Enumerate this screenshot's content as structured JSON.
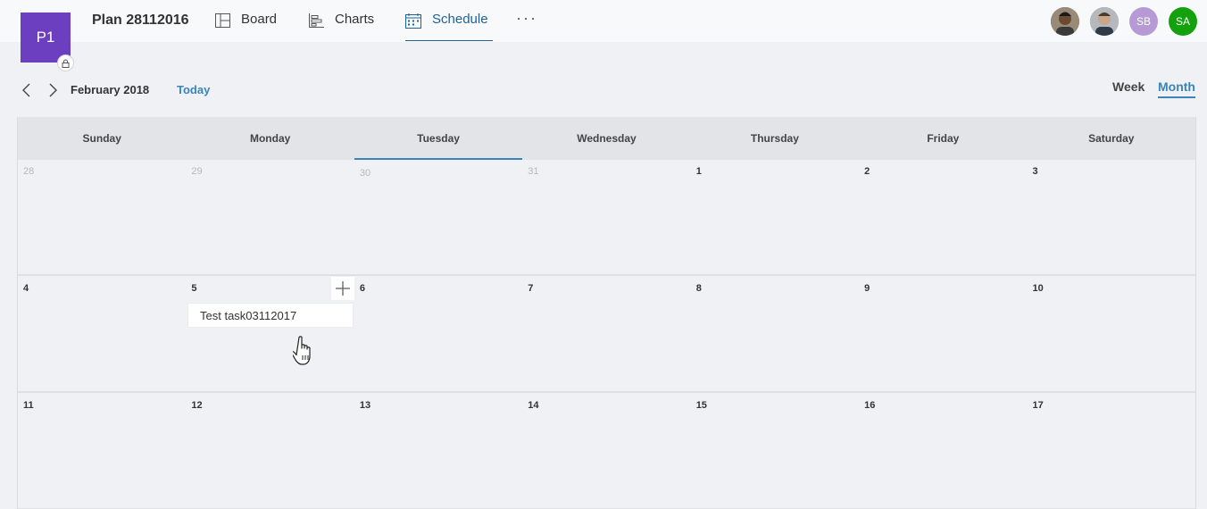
{
  "plan": {
    "tile_text": "P1",
    "tile_color": "#6b3fc0",
    "title": "Plan 28112016"
  },
  "nav": {
    "tabs": [
      {
        "label": "Board",
        "icon": "board-icon"
      },
      {
        "label": "Charts",
        "icon": "charts-icon"
      },
      {
        "label": "Schedule",
        "icon": "calendar-icon",
        "active": true
      }
    ],
    "more": "···"
  },
  "members": [
    {
      "initials": "",
      "type": "photo"
    },
    {
      "initials": "",
      "type": "photo"
    },
    {
      "initials": "SB",
      "color": "#b69ad6"
    },
    {
      "initials": "SA",
      "color": "#13a10e"
    }
  ],
  "toolbar": {
    "month": "February 2018",
    "today": "Today",
    "views": [
      "Week",
      "Month"
    ],
    "active_view": "Month",
    "accent": "#3a84b8"
  },
  "calendar": {
    "day_names": [
      "Sunday",
      "Monday",
      "Tuesday",
      "Wednesday",
      "Thursday",
      "Friday",
      "Saturday"
    ],
    "today_column": "Tuesday",
    "weeks": [
      [
        {
          "d": "28",
          "muted": true
        },
        {
          "d": "29",
          "muted": true
        },
        {
          "d": "30",
          "muted": true
        },
        {
          "d": "31",
          "muted": true
        },
        {
          "d": "1"
        },
        {
          "d": "2"
        },
        {
          "d": "3"
        }
      ],
      [
        {
          "d": "4"
        },
        {
          "d": "5"
        },
        {
          "d": "6"
        },
        {
          "d": "7"
        },
        {
          "d": "8"
        },
        {
          "d": "9"
        },
        {
          "d": "10"
        }
      ],
      [
        {
          "d": "11"
        },
        {
          "d": "12"
        },
        {
          "d": "13"
        },
        {
          "d": "14"
        },
        {
          "d": "15"
        },
        {
          "d": "16"
        },
        {
          "d": "17"
        }
      ]
    ],
    "task": {
      "title": "Test task03112017",
      "day": "5"
    }
  }
}
